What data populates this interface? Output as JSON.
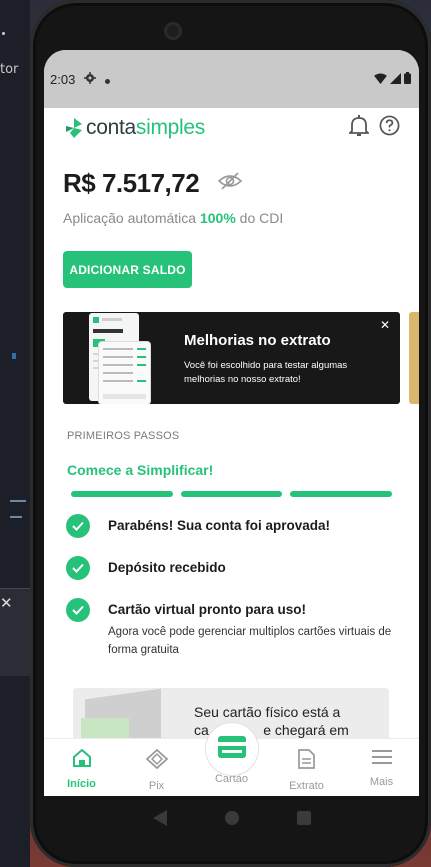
{
  "desktop": {
    "side_text": "tor",
    "close_glyph": "✕"
  },
  "status_bar": {
    "time": "2:03",
    "icons": [
      "gear-icon",
      "dot-icon",
      "wifi-icon",
      "signal-icon",
      "battery-icon"
    ]
  },
  "header": {
    "logo_part1": "conta",
    "logo_part2": "simples",
    "icons": [
      "bell-icon",
      "help-icon"
    ]
  },
  "account": {
    "balance": "R$ 7.517,72",
    "yield_prefix": "Aplicação automática ",
    "yield_pct": "100%",
    "yield_suffix": " do CDI",
    "add_button": "ADICIONAR SALDO"
  },
  "banner": {
    "title": "Melhorias no extrato",
    "description": "Você foi escolhido para testar algumas melhorias no nosso extrato!",
    "close": "✕"
  },
  "onboarding": {
    "section_label": "PRIMEIROS PASSOS",
    "title": "Comece a Simplificar!",
    "progress_steps_done": 3,
    "progress_steps_total": 3,
    "steps": [
      {
        "title": "Parabéns! Sua conta foi aprovada!",
        "desc": ""
      },
      {
        "title": "Depósito recebido",
        "desc": ""
      },
      {
        "title": "Cartão virtual pronto para uso!",
        "desc": "Agora você pode gerenciar multiplos cartões virtuais de forma gratuita"
      }
    ]
  },
  "card_promo": {
    "text_line1": "Seu cartão físico está a",
    "text_line2": "ca              e chegará em"
  },
  "bottom_nav": {
    "items": [
      {
        "label": "Início",
        "icon": "home-icon",
        "active": true
      },
      {
        "label": "Pix",
        "icon": "pix-icon",
        "active": false
      },
      {
        "label": "Cartão",
        "icon": "card-icon",
        "active": false
      },
      {
        "label": "Extrato",
        "icon": "statement-icon",
        "active": false
      },
      {
        "label": "Mais",
        "icon": "menu-icon",
        "active": false
      }
    ]
  },
  "colors": {
    "brand_green": "#27c27a",
    "dark_text": "#1c1c1c",
    "banner_bg": "#181818"
  }
}
